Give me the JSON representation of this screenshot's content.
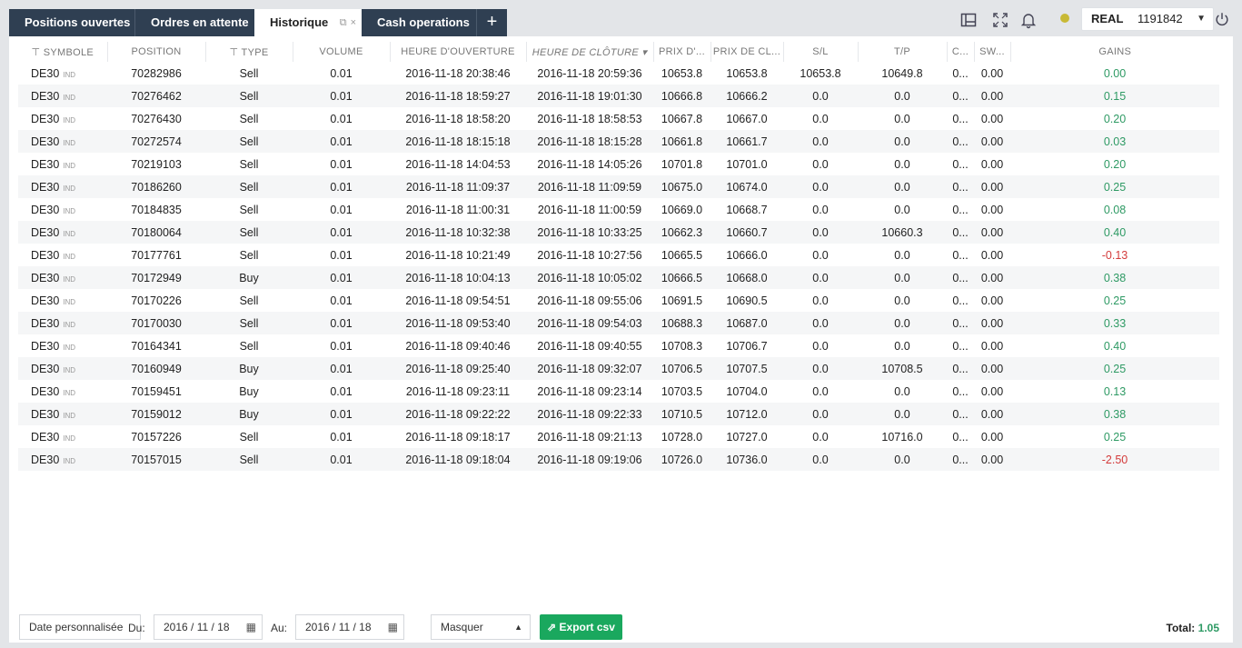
{
  "tabs": [
    {
      "label": "Positions ouvertes",
      "active": false
    },
    {
      "label": "Ordres en attente",
      "active": false
    },
    {
      "label": "Historique",
      "active": true
    },
    {
      "label": "Cash operations",
      "active": false
    }
  ],
  "toolbar": {
    "account_type": "REAL",
    "account_number": "1191842",
    "icons": [
      "layout-icon",
      "fullscreen-icon",
      "bell-icon",
      "status-dot",
      "power-icon"
    ],
    "status_color": "#c8b935"
  },
  "columns": [
    "SYMBOLE",
    "POSITION",
    "TYPE",
    "VOLUME",
    "HEURE D'OUVERTURE",
    "HEURE DE CLÔTURE",
    "PRIX D'...",
    "PRIX DE CL...",
    "S/L",
    "T/P",
    "C...",
    "SW...",
    "GAINS"
  ],
  "rows": [
    [
      "DE30",
      "70282986",
      "Sell",
      "0.01",
      "2016-11-18 20:38:46",
      "2016-11-18 20:59:36",
      "10653.8",
      "10653.8",
      "10653.8",
      "10649.8",
      "0...",
      "0.00",
      "0.00"
    ],
    [
      "DE30",
      "70276462",
      "Sell",
      "0.01",
      "2016-11-18 18:59:27",
      "2016-11-18 19:01:30",
      "10666.8",
      "10666.2",
      "0.0",
      "0.0",
      "0...",
      "0.00",
      "0.15"
    ],
    [
      "DE30",
      "70276430",
      "Sell",
      "0.01",
      "2016-11-18 18:58:20",
      "2016-11-18 18:58:53",
      "10667.8",
      "10667.0",
      "0.0",
      "0.0",
      "0...",
      "0.00",
      "0.20"
    ],
    [
      "DE30",
      "70272574",
      "Sell",
      "0.01",
      "2016-11-18 18:15:18",
      "2016-11-18 18:15:28",
      "10661.8",
      "10661.7",
      "0.0",
      "0.0",
      "0...",
      "0.00",
      "0.03"
    ],
    [
      "DE30",
      "70219103",
      "Sell",
      "0.01",
      "2016-11-18 14:04:53",
      "2016-11-18 14:05:26",
      "10701.8",
      "10701.0",
      "0.0",
      "0.0",
      "0...",
      "0.00",
      "0.20"
    ],
    [
      "DE30",
      "70186260",
      "Sell",
      "0.01",
      "2016-11-18 11:09:37",
      "2016-11-18 11:09:59",
      "10675.0",
      "10674.0",
      "0.0",
      "0.0",
      "0...",
      "0.00",
      "0.25"
    ],
    [
      "DE30",
      "70184835",
      "Sell",
      "0.01",
      "2016-11-18 11:00:31",
      "2016-11-18 11:00:59",
      "10669.0",
      "10668.7",
      "0.0",
      "0.0",
      "0...",
      "0.00",
      "0.08"
    ],
    [
      "DE30",
      "70180064",
      "Sell",
      "0.01",
      "2016-11-18 10:32:38",
      "2016-11-18 10:33:25",
      "10662.3",
      "10660.7",
      "0.0",
      "10660.3",
      "0...",
      "0.00",
      "0.40"
    ],
    [
      "DE30",
      "70177761",
      "Sell",
      "0.01",
      "2016-11-18 10:21:49",
      "2016-11-18 10:27:56",
      "10665.5",
      "10666.0",
      "0.0",
      "0.0",
      "0...",
      "0.00",
      "-0.13"
    ],
    [
      "DE30",
      "70172949",
      "Buy",
      "0.01",
      "2016-11-18 10:04:13",
      "2016-11-18 10:05:02",
      "10666.5",
      "10668.0",
      "0.0",
      "0.0",
      "0...",
      "0.00",
      "0.38"
    ],
    [
      "DE30",
      "70170226",
      "Sell",
      "0.01",
      "2016-11-18 09:54:51",
      "2016-11-18 09:55:06",
      "10691.5",
      "10690.5",
      "0.0",
      "0.0",
      "0...",
      "0.00",
      "0.25"
    ],
    [
      "DE30",
      "70170030",
      "Sell",
      "0.01",
      "2016-11-18 09:53:40",
      "2016-11-18 09:54:03",
      "10688.3",
      "10687.0",
      "0.0",
      "0.0",
      "0...",
      "0.00",
      "0.33"
    ],
    [
      "DE30",
      "70164341",
      "Sell",
      "0.01",
      "2016-11-18 09:40:46",
      "2016-11-18 09:40:55",
      "10708.3",
      "10706.7",
      "0.0",
      "0.0",
      "0...",
      "0.00",
      "0.40"
    ],
    [
      "DE30",
      "70160949",
      "Buy",
      "0.01",
      "2016-11-18 09:25:40",
      "2016-11-18 09:32:07",
      "10706.5",
      "10707.5",
      "0.0",
      "10708.5",
      "0...",
      "0.00",
      "0.25"
    ],
    [
      "DE30",
      "70159451",
      "Buy",
      "0.01",
      "2016-11-18 09:23:11",
      "2016-11-18 09:23:14",
      "10703.5",
      "10704.0",
      "0.0",
      "0.0",
      "0...",
      "0.00",
      "0.13"
    ],
    [
      "DE30",
      "70159012",
      "Buy",
      "0.01",
      "2016-11-18 09:22:22",
      "2016-11-18 09:22:33",
      "10710.5",
      "10712.0",
      "0.0",
      "0.0",
      "0...",
      "0.00",
      "0.38"
    ],
    [
      "DE30",
      "70157226",
      "Sell",
      "0.01",
      "2016-11-18 09:18:17",
      "2016-11-18 09:21:13",
      "10728.0",
      "10727.0",
      "0.0",
      "10716.0",
      "0...",
      "0.00",
      "0.25"
    ],
    [
      "DE30",
      "70157015",
      "Sell",
      "0.01",
      "2016-11-18 09:18:04",
      "2016-11-18 09:19:06",
      "10726.0",
      "10736.0",
      "0.0",
      "0.0",
      "0...",
      "0.00",
      "-2.50"
    ]
  ],
  "symbol_tag": "IND",
  "footer": {
    "period_select": "Date personnalisée",
    "from_label": "Du:",
    "from_value": "2016 / 11 / 18",
    "to_label": "Au:",
    "to_value": "2016 / 11 / 18",
    "mask_select": "Masquer",
    "export_label": "Export csv",
    "total_label": "Total:",
    "total_value": "1.05"
  },
  "colors": {
    "positive": "#2e9a64",
    "negative": "#d33b3b",
    "tab_dark": "#2f3f52",
    "export_green": "#1aa85e"
  }
}
